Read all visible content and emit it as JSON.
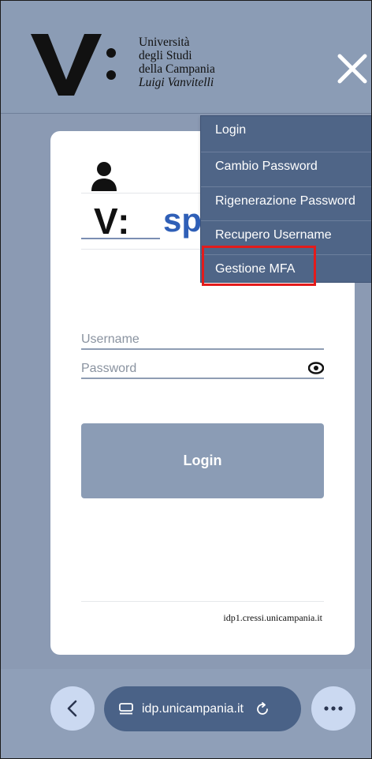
{
  "header": {
    "university_lines": [
      "Università",
      "degli Studi",
      "della Campania",
      "Luigi Vanvitelli"
    ]
  },
  "menu": {
    "items": [
      {
        "label": "Login"
      },
      {
        "label": "Cambio Password"
      },
      {
        "label": "Rigenerazione Password"
      },
      {
        "label": "Recupero Username"
      },
      {
        "label": "Gestione MFA"
      }
    ],
    "highlighted_item": "Gestione MFA",
    "highlight_color": "#e31b1b"
  },
  "brand": {
    "mark": "V:",
    "partial_text": "sp"
  },
  "form": {
    "username_placeholder": "Username",
    "password_placeholder": "Password",
    "login_label": "Login"
  },
  "footer": {
    "host": "idp1.cressi.unicampania.it"
  },
  "browser": {
    "url": "idp.unicampania.it",
    "icons": [
      "back-icon",
      "tabs-icon",
      "reload-icon",
      "more-icon"
    ]
  },
  "colors": {
    "header_bg": "#8b9cb5",
    "menu_bg": "#4f6587",
    "button_bg": "#8b9cb5",
    "brand_blue": "#2f5fb7",
    "url_pill_bg": "#4a6287"
  }
}
